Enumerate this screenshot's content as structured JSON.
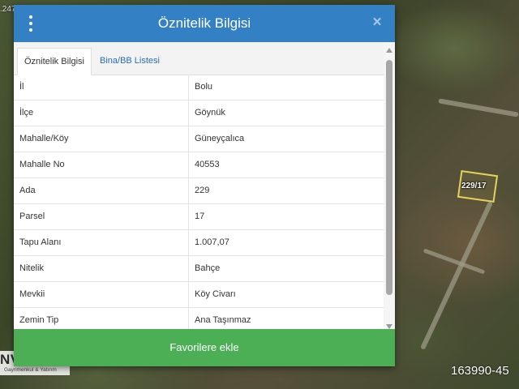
{
  "map": {
    "coord_fragment": ".247",
    "parcel_label": "229/17",
    "listing_id": "163990-45"
  },
  "logo": {
    "main": "NVESTRA",
    "sub": "Gayrimenkul & Yatırım"
  },
  "dialog": {
    "title": "Öznitelik Bilgisi",
    "menu_icon": "vertical-dots-icon",
    "close_icon": "close-icon",
    "tabs": [
      {
        "label": "Öznitelik Bilgisi",
        "active": true
      },
      {
        "label": "Bina/BB Listesi",
        "active": false
      }
    ],
    "rows": [
      {
        "key": "İl",
        "value": "Bolu"
      },
      {
        "key": "İlçe",
        "value": "Göynük"
      },
      {
        "key": "Mahalle/Köy",
        "value": "Güneyçalıca"
      },
      {
        "key": "Mahalle No",
        "value": "40553"
      },
      {
        "key": "Ada",
        "value": "229"
      },
      {
        "key": "Parsel",
        "value": "17"
      },
      {
        "key": "Tapu Alanı",
        "value": "1.007,07"
      },
      {
        "key": "Nitelik",
        "value": "Bahçe"
      },
      {
        "key": "Mevkii",
        "value": "Köy Civarı"
      },
      {
        "key": "Zemin Tip",
        "value": "Ana Taşınmaz"
      }
    ],
    "favorite_button": "Favorilere ekle"
  },
  "colors": {
    "header": "#3480c4",
    "button": "#4caf55",
    "tab_link": "#2a6db0"
  }
}
